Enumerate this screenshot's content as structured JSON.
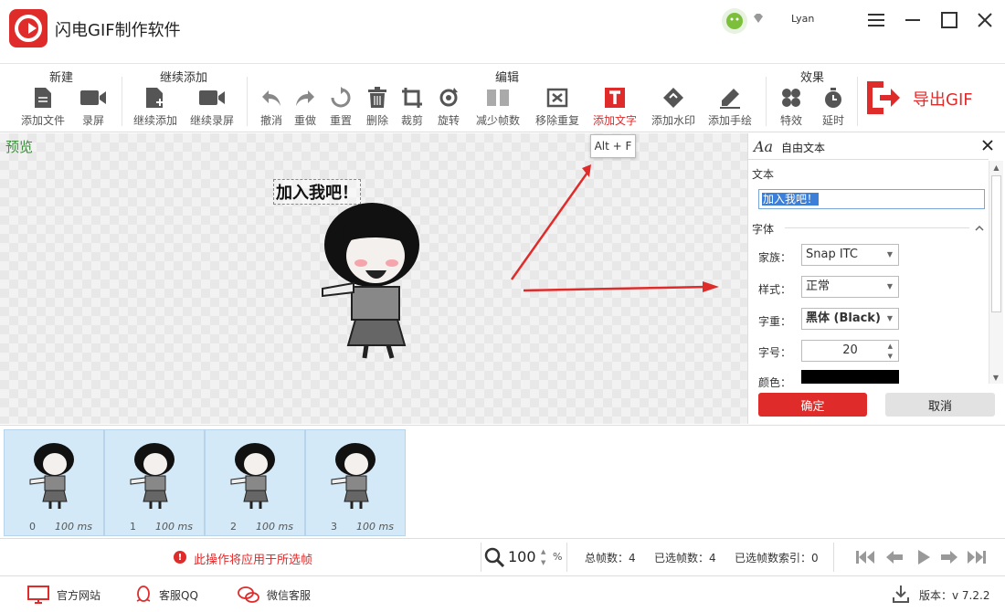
{
  "app": {
    "title": "闪电GIF制作软件",
    "user": "Lyan"
  },
  "toolbar": {
    "groups": {
      "new": "新建",
      "continue": "继续添加",
      "edit": "编辑",
      "effects": "效果"
    },
    "buttons": {
      "add_file": "添加文件",
      "record": "录屏",
      "continue_add": "继续添加",
      "continue_record": "继续录屏",
      "undo": "撤消",
      "redo": "重做",
      "reset": "重置",
      "delete": "删除",
      "crop": "裁剪",
      "rotate": "旋转",
      "reduce_frames": "减少帧数",
      "remove_duplicate": "移除重复",
      "add_text": "添加文字",
      "add_watermark": "添加水印",
      "add_handdraw": "添加手绘",
      "effects": "特效",
      "delay": "延时"
    },
    "export_label": "导出GIF"
  },
  "preview": {
    "label": "预览",
    "caption": "加入我吧！",
    "tooltip": "Alt + F"
  },
  "panel": {
    "title": "自由文本",
    "icon_text": "Aa",
    "text_section": "文本",
    "text_value": "加入我吧！",
    "font_section": "字体",
    "family_label": "家族：",
    "family_value": "Snap ITC",
    "style_label": "样式：",
    "style_value": "正常",
    "weight_label": "字重：",
    "weight_value": "黑体 (Black)",
    "size_label": "字号：",
    "size_value": "20",
    "color_label": "颜色：",
    "color_value": "#000000",
    "ok": "确定",
    "cancel": "取消"
  },
  "frames": [
    {
      "index": "0",
      "duration": "100 ms"
    },
    {
      "index": "1",
      "duration": "100 ms"
    },
    {
      "index": "2",
      "duration": "100 ms"
    },
    {
      "index": "3",
      "duration": "100 ms"
    }
  ],
  "status": {
    "warning": "此操作将应用于所选帧",
    "zoom": "100",
    "zoom_unit": "%",
    "total_frames": "总帧数：4",
    "selected_frames": "已选帧数：4",
    "selected_index": "已选帧数索引：0"
  },
  "footer": {
    "website": "官方网站",
    "qq": "客服QQ",
    "wechat": "微信客服",
    "version": "版本：v 7.2.2"
  },
  "colors": {
    "accent": "#e02b2b",
    "frame_bg": "#d4e9f7",
    "preview_label": "#3c8c3c"
  }
}
